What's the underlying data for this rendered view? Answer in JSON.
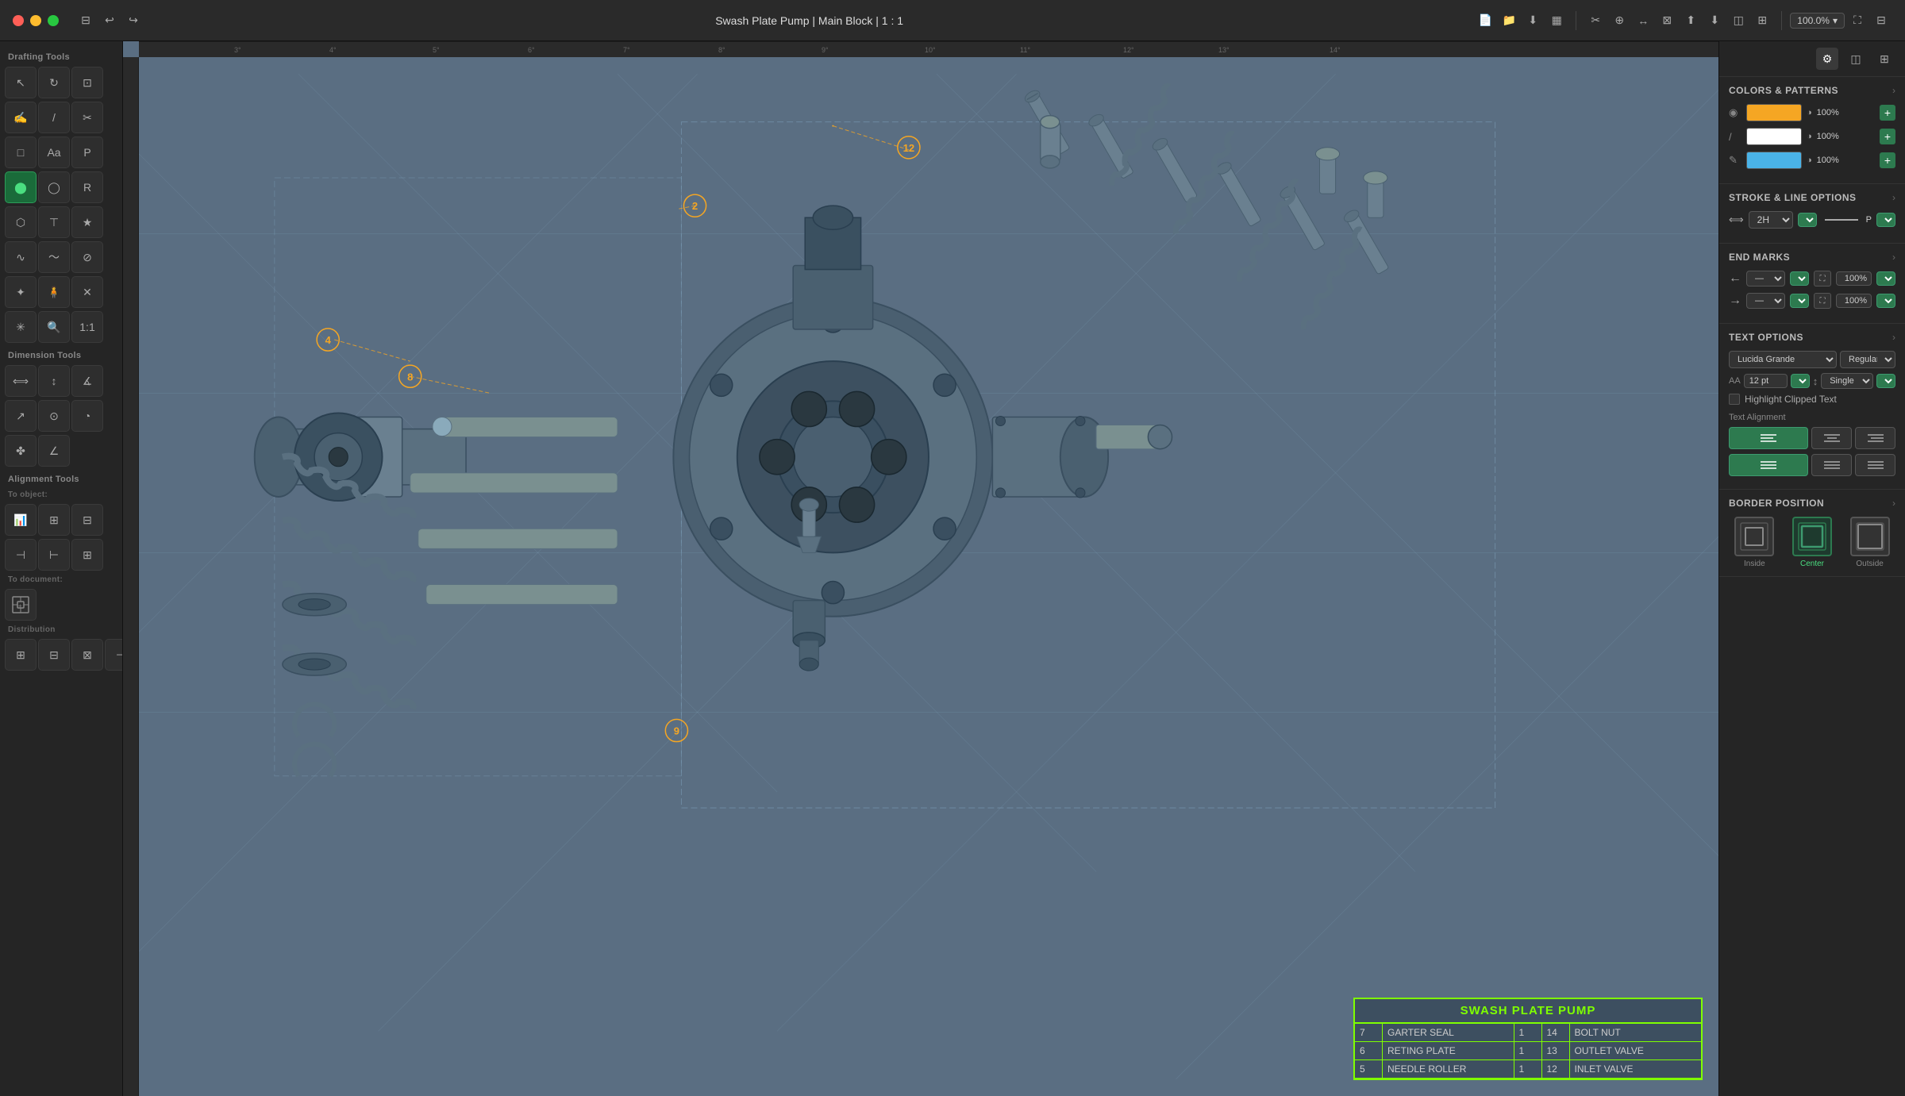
{
  "titlebar": {
    "title": "Swash Plate Pump | Main Block | 1 : 1",
    "zoom": "100.0%"
  },
  "toolbar": {
    "undo": "↩",
    "redo": "↪",
    "nav_icons": [
      "⊞",
      "☁",
      "⬇",
      "▦",
      "✂",
      "⊕",
      "⊟",
      "⊠",
      "🔧",
      "📐",
      "📋",
      "⚙"
    ]
  },
  "tools": {
    "drafting_label": "Drafting Tools",
    "dimension_label": "Dimension Tools",
    "alignment_label": "Alignment Tools",
    "to_object_label": "To object:",
    "to_document_label": "To document:",
    "distribution_label": "Distribution"
  },
  "right_panel": {
    "colors_patterns_title": "COLORS & PATTERNS",
    "colors": [
      {
        "type": "fill",
        "color": "#f5a623",
        "pct": "100%"
      },
      {
        "type": "stroke",
        "color": "#ffffff",
        "pct": "100%"
      },
      {
        "type": "accent",
        "color": "#4ab3e8",
        "pct": "100%"
      }
    ],
    "stroke_line_title": "STROKE & LINE OPTIONS",
    "stroke_weight": "2H",
    "stroke_end": "P",
    "end_marks_title": "END MARKS",
    "end_mark_left_pct": "100%",
    "end_mark_right_pct": "100%",
    "text_options_title": "TEXT OPTIONS",
    "font_family": "Lucida Grande",
    "font_style": "Regular",
    "font_size": "12 pt",
    "line_spacing": "Single",
    "highlight_clipped": "Highlight Clipped Text",
    "text_alignment_label": "Text Alignment",
    "border_position_title": "BORDER POSITION",
    "border_positions": [
      "Inside",
      "Center",
      "Outside"
    ]
  },
  "bom": {
    "title": "SWASH PLATE PUMP",
    "rows": [
      {
        "item": "7",
        "description": "GARTER SEAL",
        "qty": "1",
        "part": "14",
        "part_name": "BOLT NUT"
      },
      {
        "item": "6",
        "description": "RETING PLATE",
        "qty": "1",
        "part": "13",
        "part_name": "OUTLET VALVE"
      },
      {
        "item": "5",
        "description": "NEEDLE ROLLER",
        "qty": "1",
        "part": "12",
        "part_name": "INLET VALVE"
      }
    ]
  },
  "part_numbers": [
    {
      "id": "2",
      "x": "540",
      "y": "120"
    },
    {
      "id": "4",
      "x": "70",
      "y": "285"
    },
    {
      "id": "8",
      "x": "175",
      "y": "330"
    },
    {
      "id": "9",
      "x": "510",
      "y": "735"
    },
    {
      "id": "12",
      "x": "800",
      "y": "50"
    }
  ],
  "icons": {
    "collapse": "›",
    "arrow_left": "←",
    "arrow_right": "→",
    "align_left": "≡",
    "align_center": "≡",
    "align_right": "≡",
    "filter": "⚙",
    "layers": "◫",
    "grid": "⊞"
  }
}
